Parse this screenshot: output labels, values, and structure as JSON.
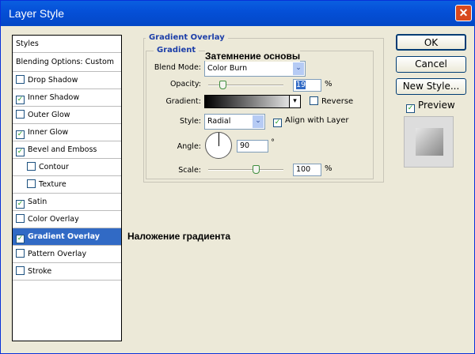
{
  "window": {
    "title": "Layer Style",
    "close": "✕"
  },
  "styles_list": {
    "header": "Styles",
    "blending": "Blending Options: Custom",
    "items": [
      {
        "label": "Drop Shadow",
        "checked": false
      },
      {
        "label": "Inner Shadow",
        "checked": true
      },
      {
        "label": "Outer Glow",
        "checked": false
      },
      {
        "label": "Inner Glow",
        "checked": true
      },
      {
        "label": "Bevel and Emboss",
        "checked": true
      },
      {
        "label": "Contour",
        "checked": false
      },
      {
        "label": "Texture",
        "checked": false
      },
      {
        "label": "Satin",
        "checked": true
      },
      {
        "label": "Color Overlay",
        "checked": false
      },
      {
        "label": "Gradient Overlay",
        "checked": true,
        "selected": true
      },
      {
        "label": "Pattern Overlay",
        "checked": false
      },
      {
        "label": "Stroke",
        "checked": false
      }
    ]
  },
  "panel": {
    "title": "Gradient Overlay",
    "group": "Gradient",
    "blend_mode_label": "Blend Mode:",
    "blend_mode": "Color Burn",
    "opacity_label": "Opacity:",
    "opacity": "19",
    "opacity_unit": "%",
    "gradient_label": "Gradient:",
    "reverse_label": "Reverse",
    "reverse": false,
    "style_label": "Style:",
    "style": "Radial",
    "align_label": "Align with Layer",
    "align": true,
    "angle_label": "Angle:",
    "angle": "90",
    "angle_unit": "°",
    "scale_label": "Scale:",
    "scale": "100",
    "scale_unit": "%"
  },
  "buttons": {
    "ok": "OK",
    "cancel": "Cancel",
    "new_style": "New Style...",
    "preview_label": "Preview",
    "preview": true
  },
  "annotations": {
    "blend": "Затемнение основы",
    "overlay": "Наложение градиента"
  },
  "check_mark": "✓",
  "dropdown_arrow": "⌄"
}
